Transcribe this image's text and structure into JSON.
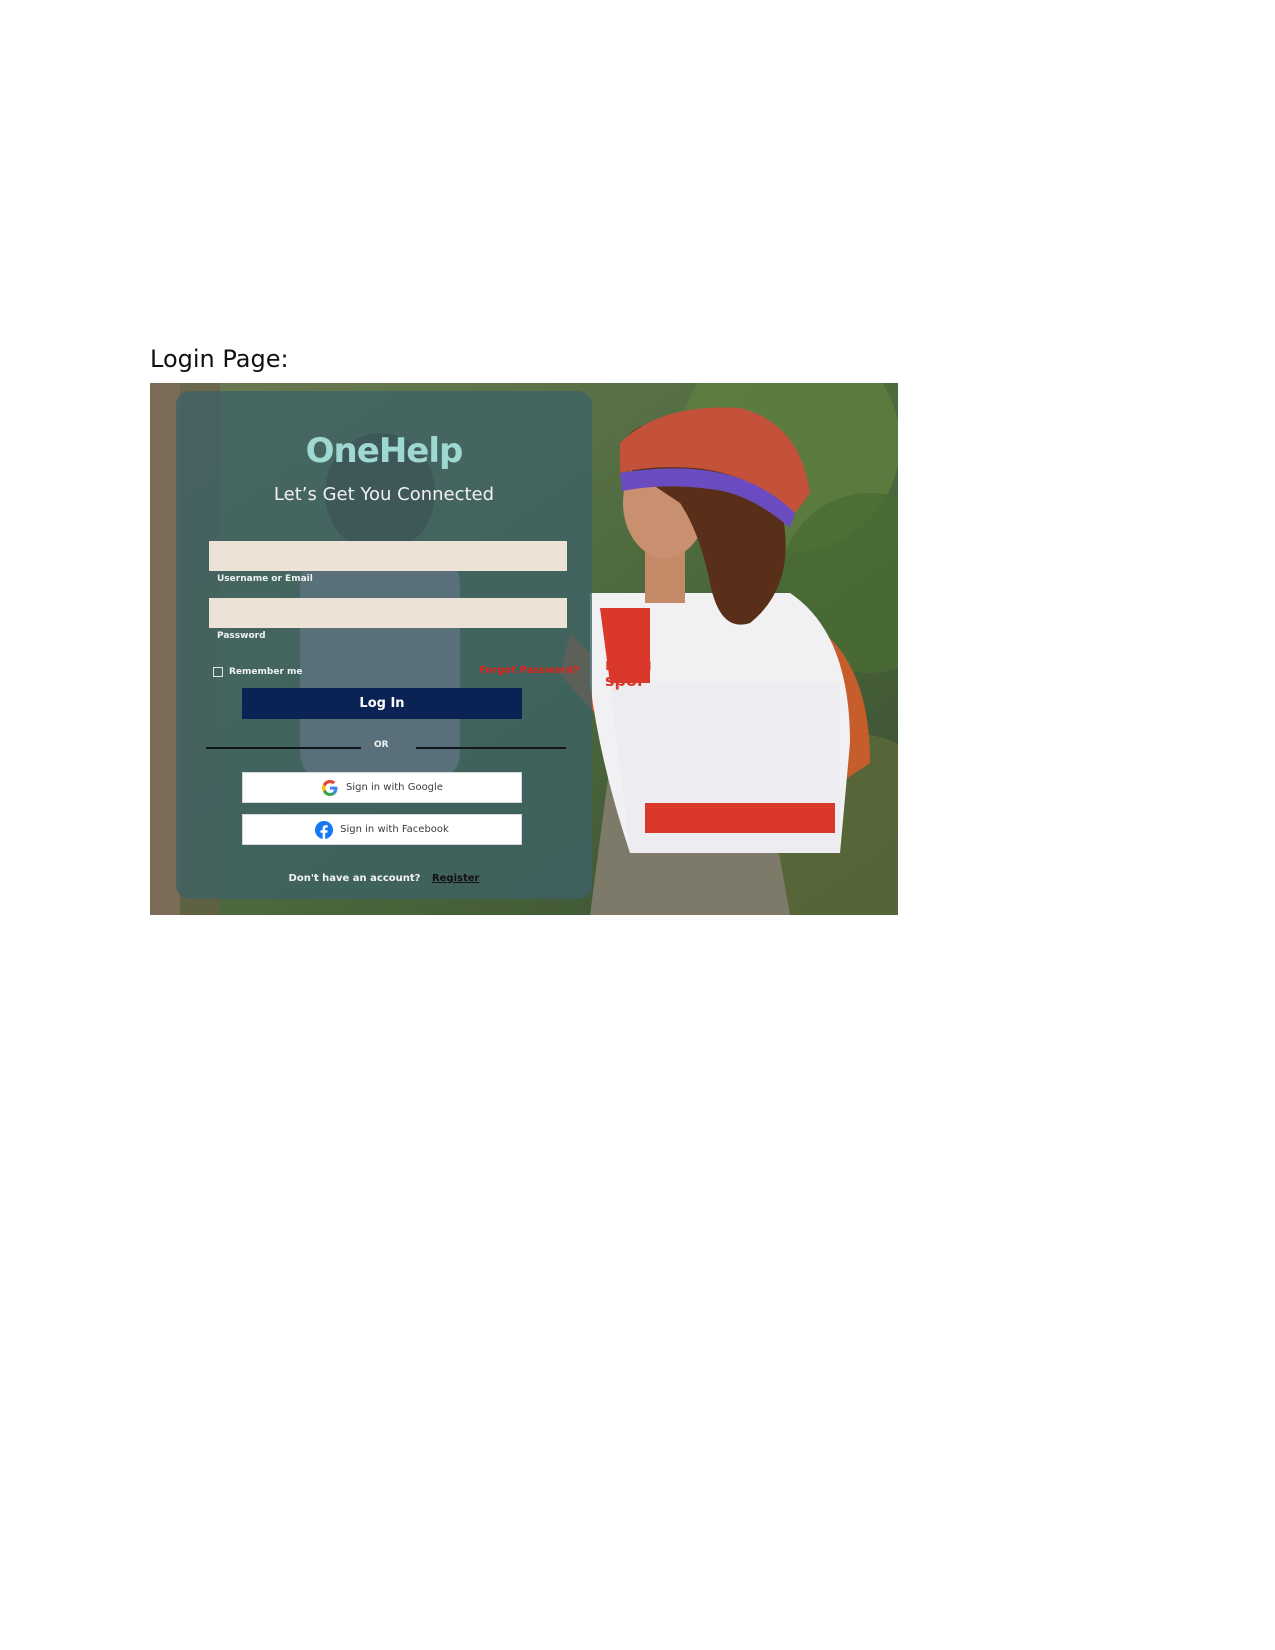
{
  "document": {
    "heading": "Login Page:"
  },
  "login": {
    "brand": "OneHelp",
    "tagline": "Let’s Get You Connected",
    "username": {
      "label": "Username or Email",
      "value": ""
    },
    "password": {
      "label": "Password",
      "value": ""
    },
    "remember_label": "Remember me",
    "forgot_label": "Forgot Password?",
    "login_button": "Log In",
    "or_label": "OR",
    "google_button": "Sign in with Google",
    "facebook_button": "Sign in with Facebook",
    "register_prompt": "Don't have an account?",
    "register_link": "Register"
  },
  "colors": {
    "brand": "#9fd8d2",
    "login_button": "#0b2354",
    "forgot": "#e2231a",
    "field_bg": "#ece3d6"
  },
  "icons": {
    "google": "google-icon",
    "facebook": "facebook-icon"
  }
}
